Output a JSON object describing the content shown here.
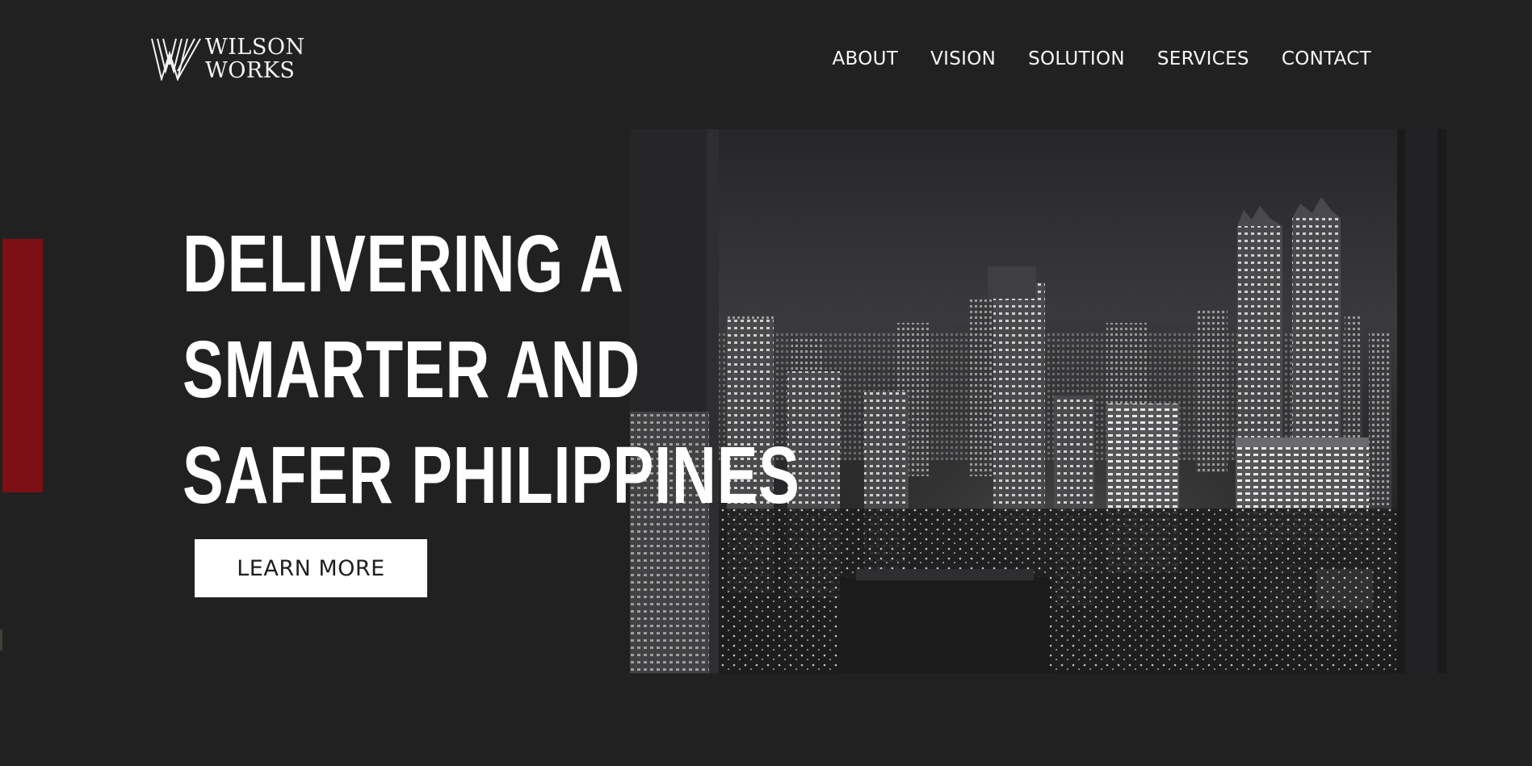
{
  "brand": {
    "line1": "WILSON",
    "line2": "WORKS",
    "logo_icon": "wilson-works-w-logo-icon"
  },
  "nav": {
    "items": [
      "ABOUT",
      "VISION",
      "SOLUTION",
      "SERVICES",
      "CONTACT"
    ]
  },
  "hero": {
    "headline": [
      "DELIVERING A",
      "SMARTER AND",
      "SAFER PHILIPPINES"
    ],
    "cta_label": "LEARN MORE",
    "image": "night-city-skyline-grayscale-photo"
  },
  "colors": {
    "background": "#212122",
    "accent": "#7c0f13",
    "text": "#ffffff",
    "button_bg": "#ffffff",
    "button_text": "#1f1f1f"
  }
}
